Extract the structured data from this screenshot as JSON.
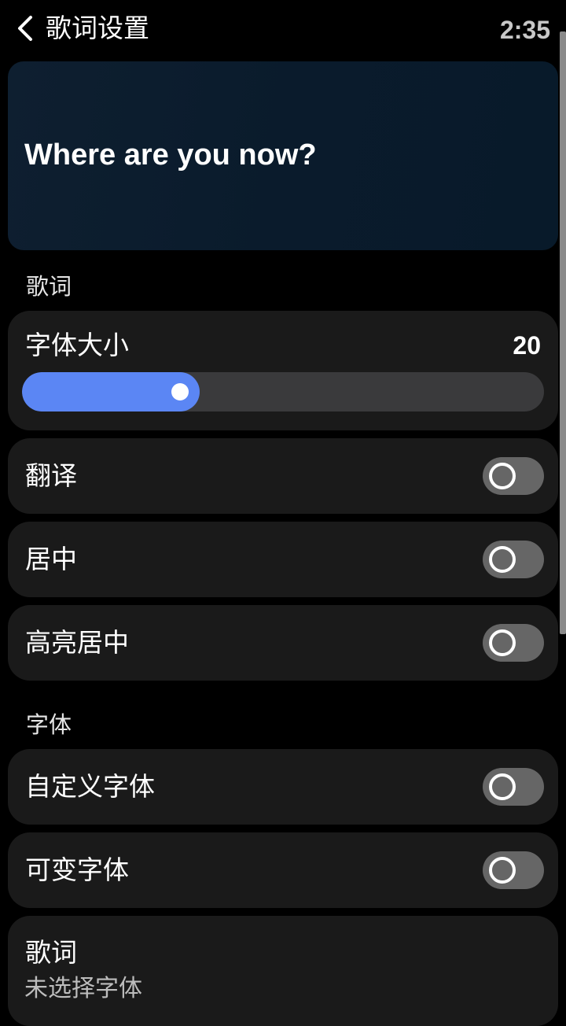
{
  "header": {
    "title": "歌词设置",
    "time": "2:35"
  },
  "preview": {
    "text": "Where are you now?"
  },
  "sections": {
    "lyrics_label": "歌词",
    "font_label": "字体"
  },
  "lyrics": {
    "font_size_label": "字体大小",
    "font_size_value": "20",
    "font_size_fraction": 0.34,
    "translate_label": "翻译",
    "translate_on": false,
    "center_label": "居中",
    "center_on": false,
    "highlight_center_label": "高亮居中",
    "highlight_center_on": false
  },
  "font": {
    "custom_font_label": "自定义字体",
    "custom_font_on": false,
    "variable_font_label": "可变字体",
    "variable_font_on": false,
    "lyrics_font_label": "歌词",
    "lyrics_font_value": "未选择字体"
  },
  "colors": {
    "accent": "#5b86f4",
    "card": "#1a1a1a",
    "toggle_off": "#666666",
    "preview_bg": "#0a1b2c"
  },
  "icons": {
    "back": "chevron-left-icon"
  }
}
